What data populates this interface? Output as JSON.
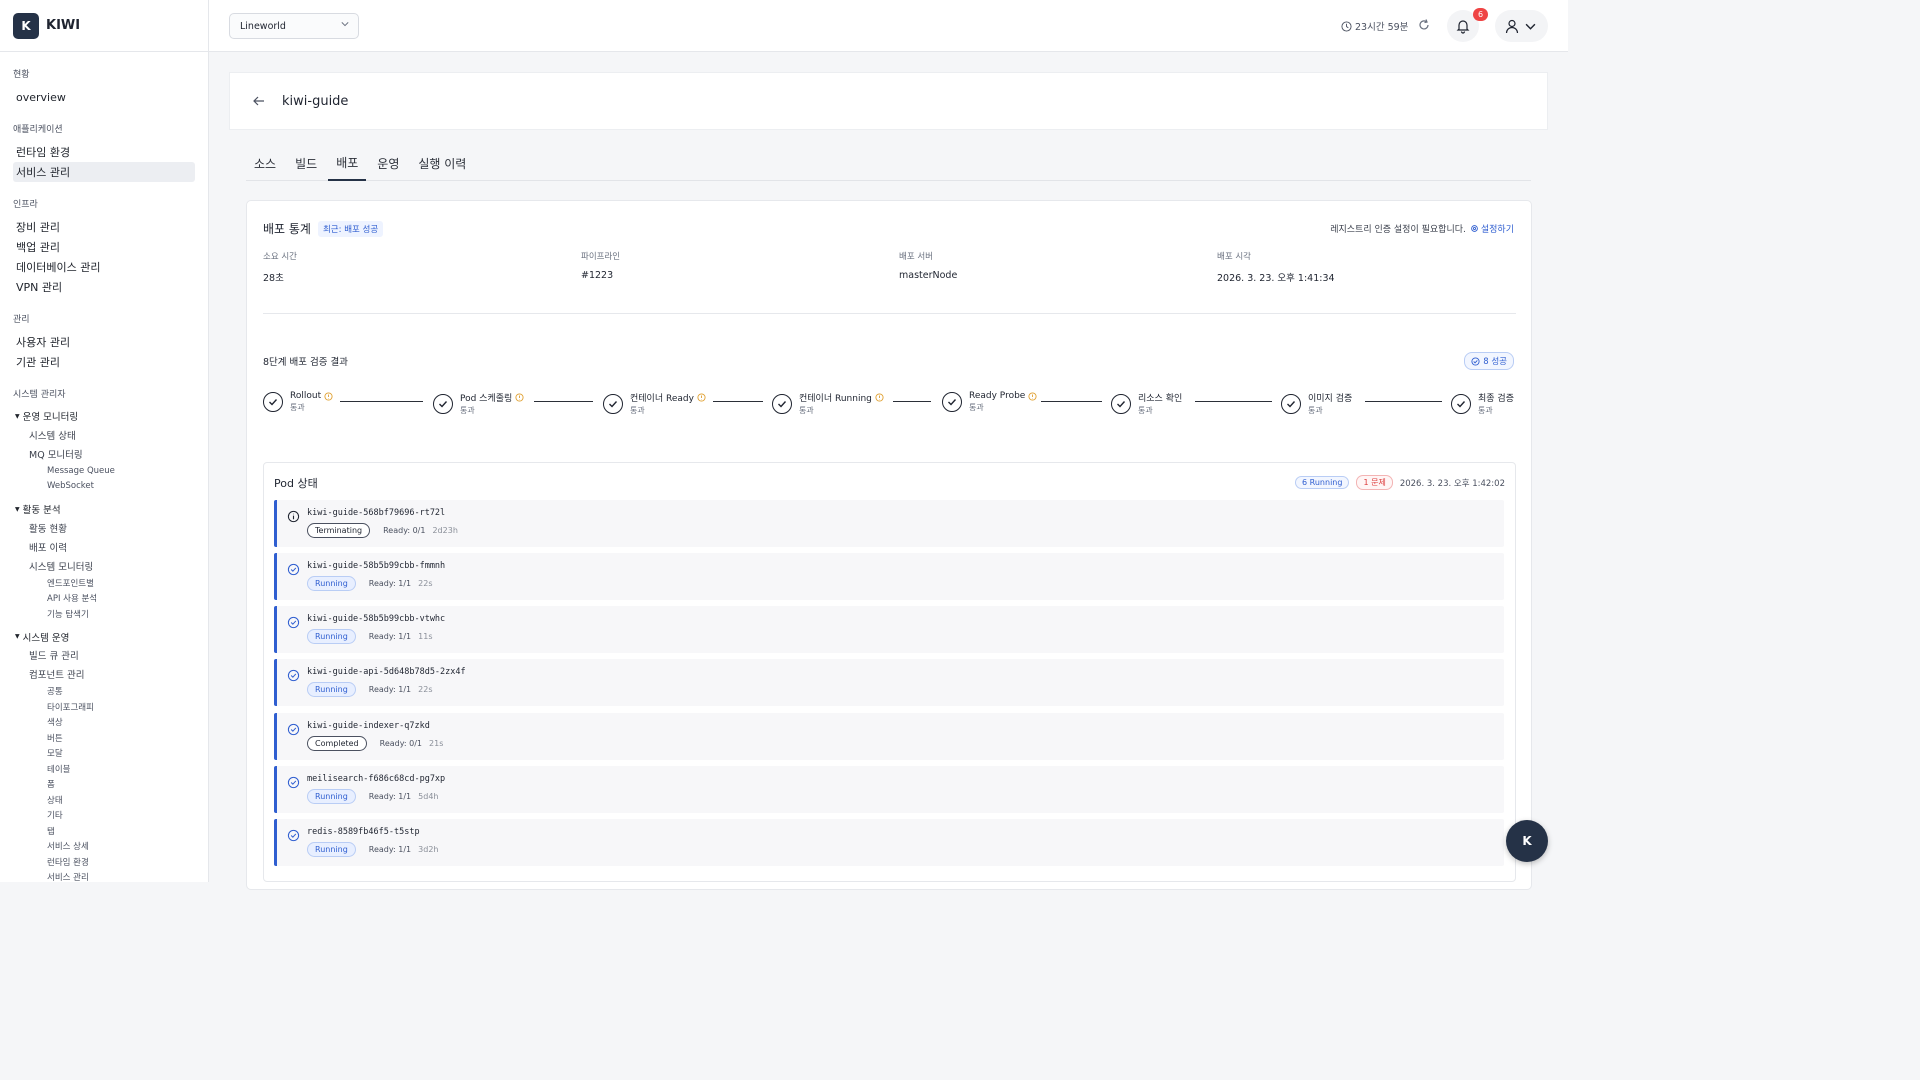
{
  "brand": {
    "logo_letter": "K",
    "name": "KIWI"
  },
  "sidebar": {
    "groups": [
      {
        "title": "현황",
        "items": [
          "overview"
        ]
      },
      {
        "title": "애플리케이션",
        "items": [
          "런타임 환경",
          "서비스 관리"
        ]
      },
      {
        "title": "인프라",
        "items": [
          "장비 관리",
          "백업 관리",
          "데이터베이스 관리",
          "VPN 관리"
        ]
      },
      {
        "title": "관리",
        "items": [
          "사용자 관리",
          "기관 관리"
        ]
      }
    ],
    "admin": {
      "title": "시스템 관리자",
      "ops_monitoring": "운영 모니터링",
      "system_status": "시스템 상태",
      "mq_monitoring": "MQ 모니터링",
      "message_queue": "Message Queue",
      "websocket": "WebSocket",
      "activity_analysis": "활동 분석",
      "activity_status": "활동 현황",
      "deploy_history": "배포 이력",
      "system_monitoring": "시스템 모니터링",
      "per_endpoint": "엔드포인트별",
      "api_usage": "API 사용 분석",
      "feature_explorer": "기능 탐색기",
      "system_ops": "시스템 운영",
      "build_queue": "빌드 큐 관리",
      "component_mgmt": "컴포넌트 관리",
      "components": [
        "공통",
        "타이포그래피",
        "색상",
        "버튼",
        "모달",
        "테이블",
        "폼",
        "상태",
        "기타",
        "탭",
        "서비스 상세",
        "런타임 환경",
        "서비스 관리"
      ]
    }
  },
  "topbar": {
    "workspace": "Lineworld",
    "session_time": "23시간 59분",
    "notification_count": "6"
  },
  "page": {
    "title": "kiwi-guide",
    "tabs": [
      "소스",
      "빌드",
      "배포",
      "운영",
      "실행 이력"
    ],
    "active_tab": "배포"
  },
  "deploy": {
    "title": "배포 통계",
    "recent_badge": "최근: 배포 성공",
    "registry_msg": "레지스트리 인증 설정이 필요합니다.",
    "registry_link": "설정하기",
    "stats": [
      {
        "label": "소요 시간",
        "value": "28초"
      },
      {
        "label": "파이프라인",
        "value": "#1223"
      },
      {
        "label": "배포 서버",
        "value": "masterNode"
      },
      {
        "label": "배포 시각",
        "value": "2026. 3. 23. 오후 1:41:34"
      }
    ],
    "stages_title": "8단계 배포 검증 결과",
    "success_count": "8 성공",
    "stages": [
      {
        "name": "Rollout",
        "status": "통과",
        "warn": true
      },
      {
        "name": "Pod 스케줄링",
        "status": "통과",
        "warn": true
      },
      {
        "name": "컨테이너 Ready",
        "status": "통과",
        "warn": true
      },
      {
        "name": "컨테이너 Running",
        "status": "통과",
        "warn": true
      },
      {
        "name": "Ready Probe",
        "status": "통과",
        "warn": true
      },
      {
        "name": "리소스 확인",
        "status": "통과",
        "warn": false
      },
      {
        "name": "이미지 검증",
        "status": "통과",
        "warn": false
      },
      {
        "name": "최종 검증",
        "status": "통과",
        "warn": false
      }
    ]
  },
  "pods": {
    "title": "Pod 상태",
    "running_badge": "6 Running",
    "issue_badge": "1 문제",
    "timestamp": "2026. 3. 23. 오후 1:42:02",
    "rows": [
      {
        "name": "kiwi-guide-568bf79696-rt72l",
        "status": "Terminating",
        "ready": "Ready: 0/1",
        "age": "2d23h",
        "icon": "info-icon"
      },
      {
        "name": "kiwi-guide-58b5b99cbb-fmmnh",
        "status": "Running",
        "ready": "Ready: 1/1",
        "age": "22s",
        "icon": "check-icon"
      },
      {
        "name": "kiwi-guide-58b5b99cbb-vtwhc",
        "status": "Running",
        "ready": "Ready: 1/1",
        "age": "11s",
        "icon": "check-icon"
      },
      {
        "name": "kiwi-guide-api-5d648b78d5-2zx4f",
        "status": "Running",
        "ready": "Ready: 1/1",
        "age": "22s",
        "icon": "check-icon"
      },
      {
        "name": "kiwi-guide-indexer-q7zkd",
        "status": "Completed",
        "ready": "Ready: 0/1",
        "age": "21s",
        "icon": "check-icon"
      },
      {
        "name": "meilisearch-f686c68cd-pg7xp",
        "status": "Running",
        "ready": "Ready: 1/1",
        "age": "5d4h",
        "icon": "check-icon"
      },
      {
        "name": "redis-8589fb46f5-t5stp",
        "status": "Running",
        "ready": "Ready: 1/1",
        "age": "3d2h",
        "icon": "check-icon"
      }
    ]
  },
  "fab": {
    "letter": "K"
  },
  "colors": {
    "brand": "#253247",
    "accent": "#2f5ed0",
    "danger": "#ef4444",
    "warn": "#e0a030"
  }
}
